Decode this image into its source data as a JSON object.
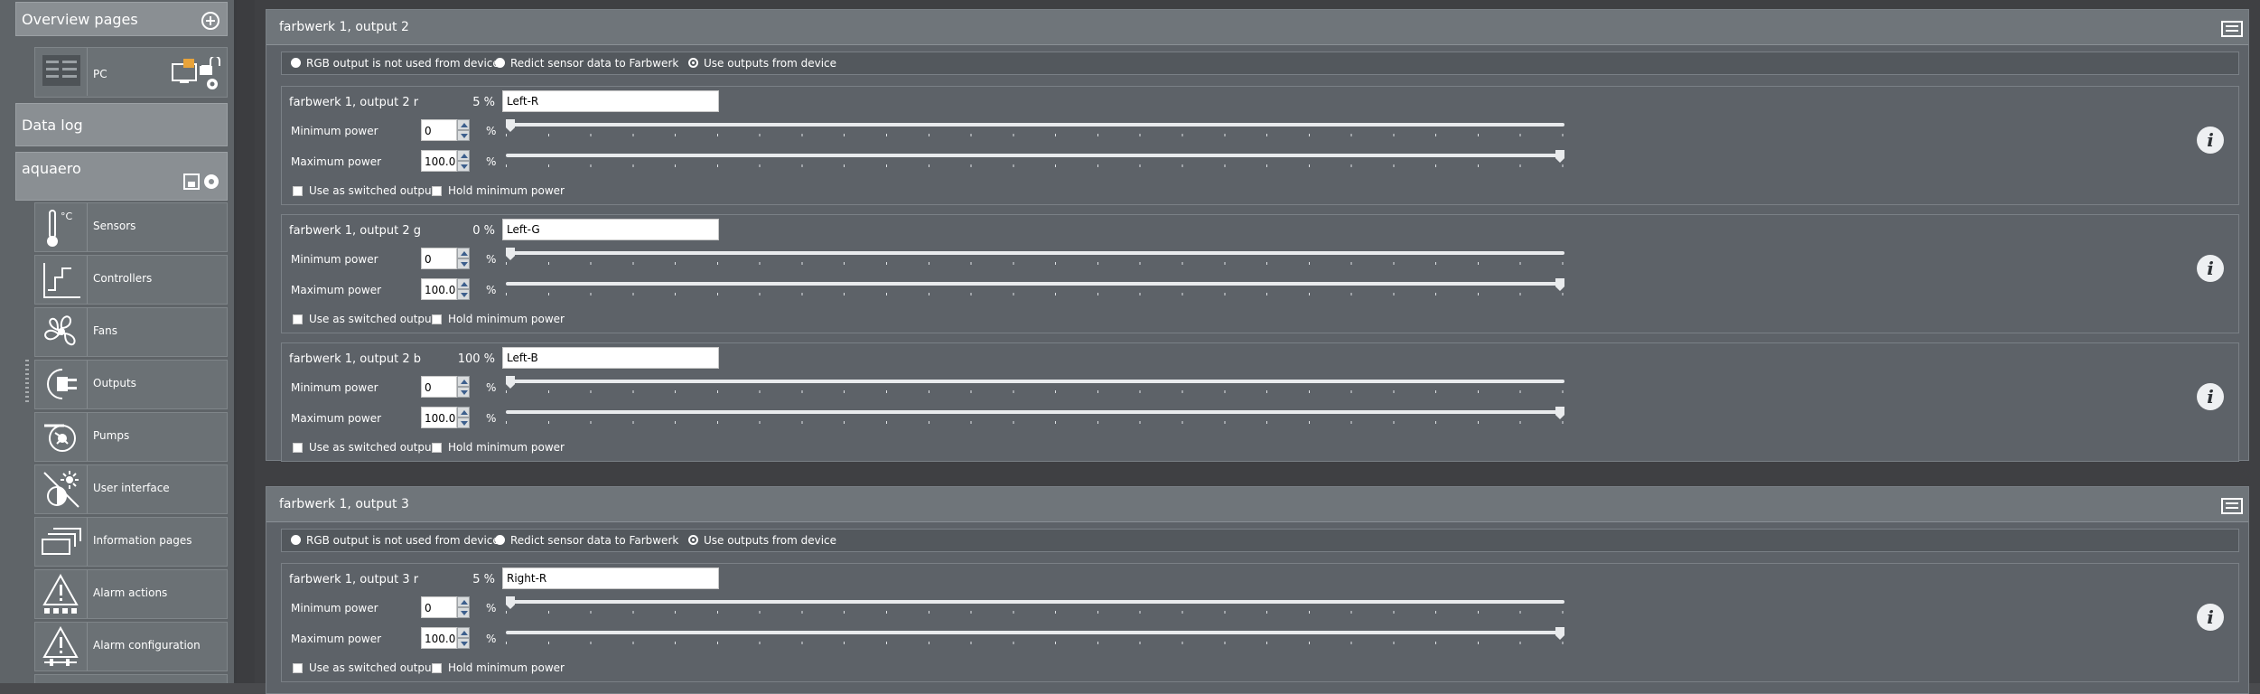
{
  "sidebar": {
    "overview_label": "Overview pages",
    "pc_label": "PC",
    "datalog_label": "Data log",
    "aquaero_label": "aquaero",
    "items": [
      {
        "label": "Sensors",
        "icon": "thermometer-icon"
      },
      {
        "label": "Controllers",
        "icon": "controller-icon"
      },
      {
        "label": "Fans",
        "icon": "fan-icon"
      },
      {
        "label": "Outputs",
        "icon": "plug-icon"
      },
      {
        "label": "Pumps",
        "icon": "pump-icon"
      },
      {
        "label": "User interface",
        "icon": "brightness-icon"
      },
      {
        "label": "Information pages",
        "icon": "pages-icon"
      },
      {
        "label": "Alarm actions",
        "icon": "alarm-actions-icon"
      },
      {
        "label": "Alarm configuration",
        "icon": "alarm-config-icon"
      }
    ],
    "sensor_unit": "°C"
  },
  "modes": {
    "opt1": "RGB output is not used from device",
    "opt2": "Redict sensor data to Farbwerk",
    "opt3": "Use outputs from device"
  },
  "labels": {
    "min_power": "Minimum power",
    "max_power": "Maximum power",
    "unit": "%",
    "switched": "Use as switched output",
    "hold_min": "Hold minimum power",
    "info": "i"
  },
  "panels": [
    {
      "title": "farbwerk 1, output 2",
      "channels": [
        {
          "title": "farbwerk 1, output 2 r",
          "percent": "5 %",
          "name": "Left-R",
          "min": "0",
          "max": "100.0",
          "min_pos": 0.0,
          "max_pos": 1.0
        },
        {
          "title": "farbwerk 1, output 2 g",
          "percent": "0 %",
          "name": "Left-G",
          "min": "0",
          "max": "100.0",
          "min_pos": 0.0,
          "max_pos": 1.0
        },
        {
          "title": "farbwerk 1, output 2 b",
          "percent": "100 %",
          "name": "Left-B",
          "min": "0",
          "max": "100.0",
          "min_pos": 0.0,
          "max_pos": 1.0
        }
      ]
    },
    {
      "title": "farbwerk 1, output 3",
      "channels": [
        {
          "title": "farbwerk 1, output 3 r",
          "percent": "5 %",
          "name": "Right-R",
          "min": "0",
          "max": "100.0",
          "min_pos": 0.0,
          "max_pos": 1.0
        }
      ]
    }
  ]
}
